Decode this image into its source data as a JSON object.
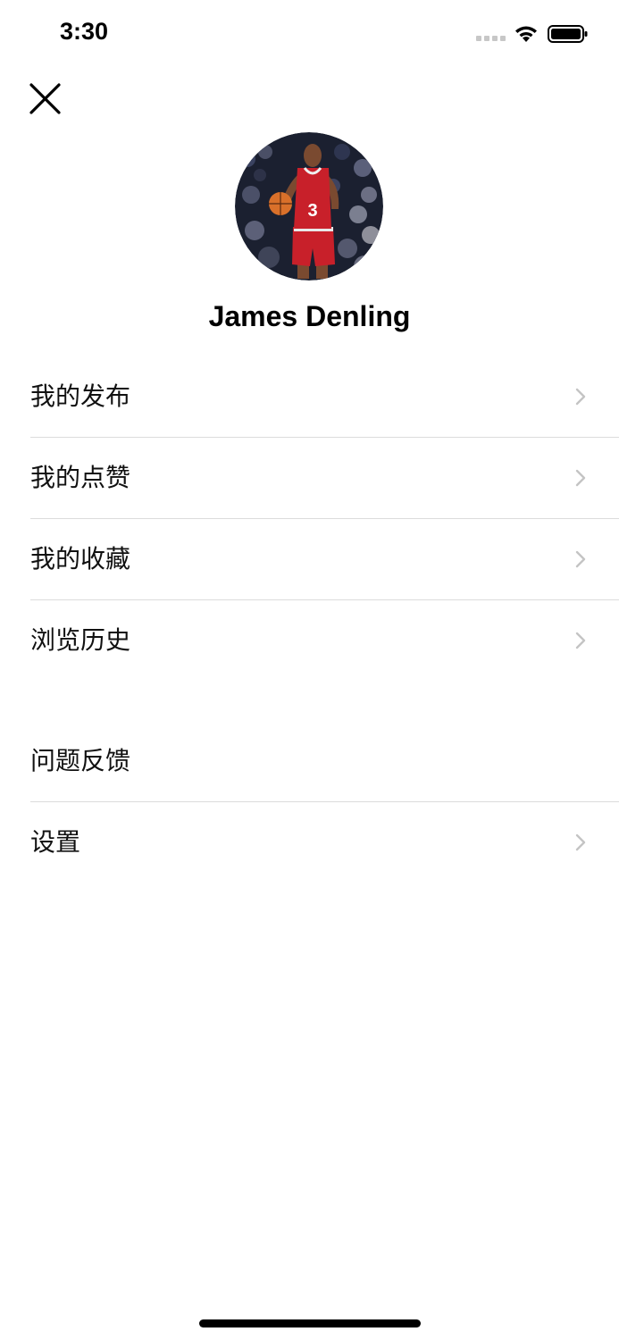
{
  "status_bar": {
    "time": "3:30",
    "signal_icon": "cellular-signal-icon",
    "wifi_icon": "wifi-icon",
    "battery_icon": "battery-icon"
  },
  "header": {
    "close_icon": "close-icon"
  },
  "profile": {
    "avatar_icon": "basketball-player-avatar",
    "name": "James Denling"
  },
  "menu_group_1": [
    {
      "label": "我的发布",
      "has_chevron": true
    },
    {
      "label": "我的点赞",
      "has_chevron": true
    },
    {
      "label": "我的收藏",
      "has_chevron": true
    },
    {
      "label": "浏览历史",
      "has_chevron": true
    }
  ],
  "menu_group_2": [
    {
      "label": "问题反馈",
      "has_chevron": false
    },
    {
      "label": "设置",
      "has_chevron": true
    }
  ],
  "colors": {
    "divider": "#dcdcdc",
    "chevron": "#c4c4c4",
    "jersey": "#c8202a",
    "background": "#ffffff"
  }
}
